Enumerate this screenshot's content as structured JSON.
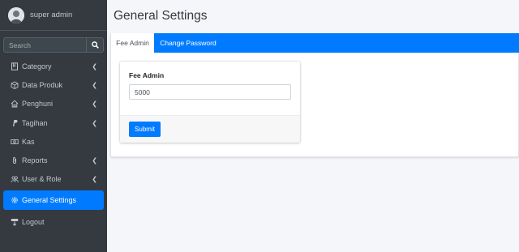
{
  "user": {
    "name": "super admin"
  },
  "search": {
    "placeholder": "Search"
  },
  "sidebar": {
    "items": [
      {
        "label": "Category",
        "icon": "bookmark-icon",
        "chevron": true
      },
      {
        "label": "Data Produk",
        "icon": "box-icon",
        "chevron": true
      },
      {
        "label": "Penghuni",
        "icon": "home-icon",
        "chevron": true
      },
      {
        "label": "Tagihan",
        "icon": "paypal-icon",
        "chevron": true
      },
      {
        "label": "Kas",
        "icon": "money-icon",
        "chevron": false
      },
      {
        "label": "Reports",
        "icon": "paperclip-icon",
        "chevron": true
      },
      {
        "label": "User & Role",
        "icon": "users-icon",
        "chevron": true
      },
      {
        "label": "General Settings",
        "icon": "gear-icon",
        "chevron": false,
        "active": true
      },
      {
        "label": "Logout",
        "icon": "logout-icon",
        "chevron": false
      }
    ]
  },
  "header": {
    "title": "General Settings"
  },
  "tabs": [
    {
      "label": "Fee Admin",
      "active": true
    },
    {
      "label": "Change Password",
      "active": false
    }
  ],
  "form": {
    "label": "Fee Admin",
    "value": "5000",
    "submit_label": "Submit"
  },
  "colors": {
    "sidebar_bg": "#343a40",
    "accent": "#007bff",
    "content_bg": "#f4f6f9"
  }
}
